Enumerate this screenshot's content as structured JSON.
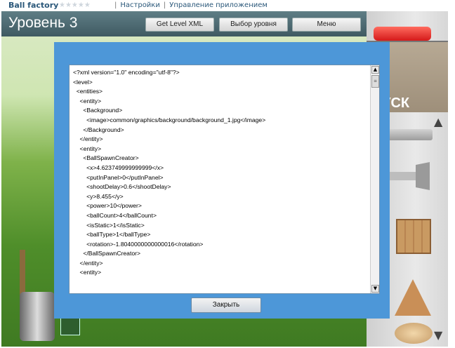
{
  "topbar": {
    "app_name": "Ball factory",
    "stars": "★★★★★",
    "link_settings": "Настройки",
    "link_manage": "Управление приложением",
    "separator": "|"
  },
  "game": {
    "level_title": "Уровень 3",
    "buttons": {
      "get_level_xml": "Get Level XML",
      "level_select": "Выбор уровня",
      "menu": "Меню"
    },
    "start_label": "УСК"
  },
  "dialog": {
    "xml_text": "<?xml version=\"1.0\" encoding=\"utf-8\"?>\n<level>\n  <entities>\n    <entity>\n      <Background>\n        <image>common/graphics/background/background_1.jpg</image>\n      </Background>\n    </entity>\n    <entity>\n      <BallSpawnCreator>\n        <x>4.623749999999999</x>\n        <putInPanel>0</putInPanel>\n        <shootDelay>0.6</shootDelay>\n        <y>8.455</y>\n        <power>10</power>\n        <ballCount>4</ballCount>\n        <isStatic>1</isStatic>\n        <ballType>1</ballType>\n        <rotation>-1.8040000000000016</rotation>\n      </BallSpawnCreator>\n    </entity>\n    <entity>",
    "close_label": "Закрыть"
  },
  "colors": {
    "dialog_bg": "#4d97d8",
    "header_bg": "#4f6d74",
    "link": "#2b587a"
  }
}
